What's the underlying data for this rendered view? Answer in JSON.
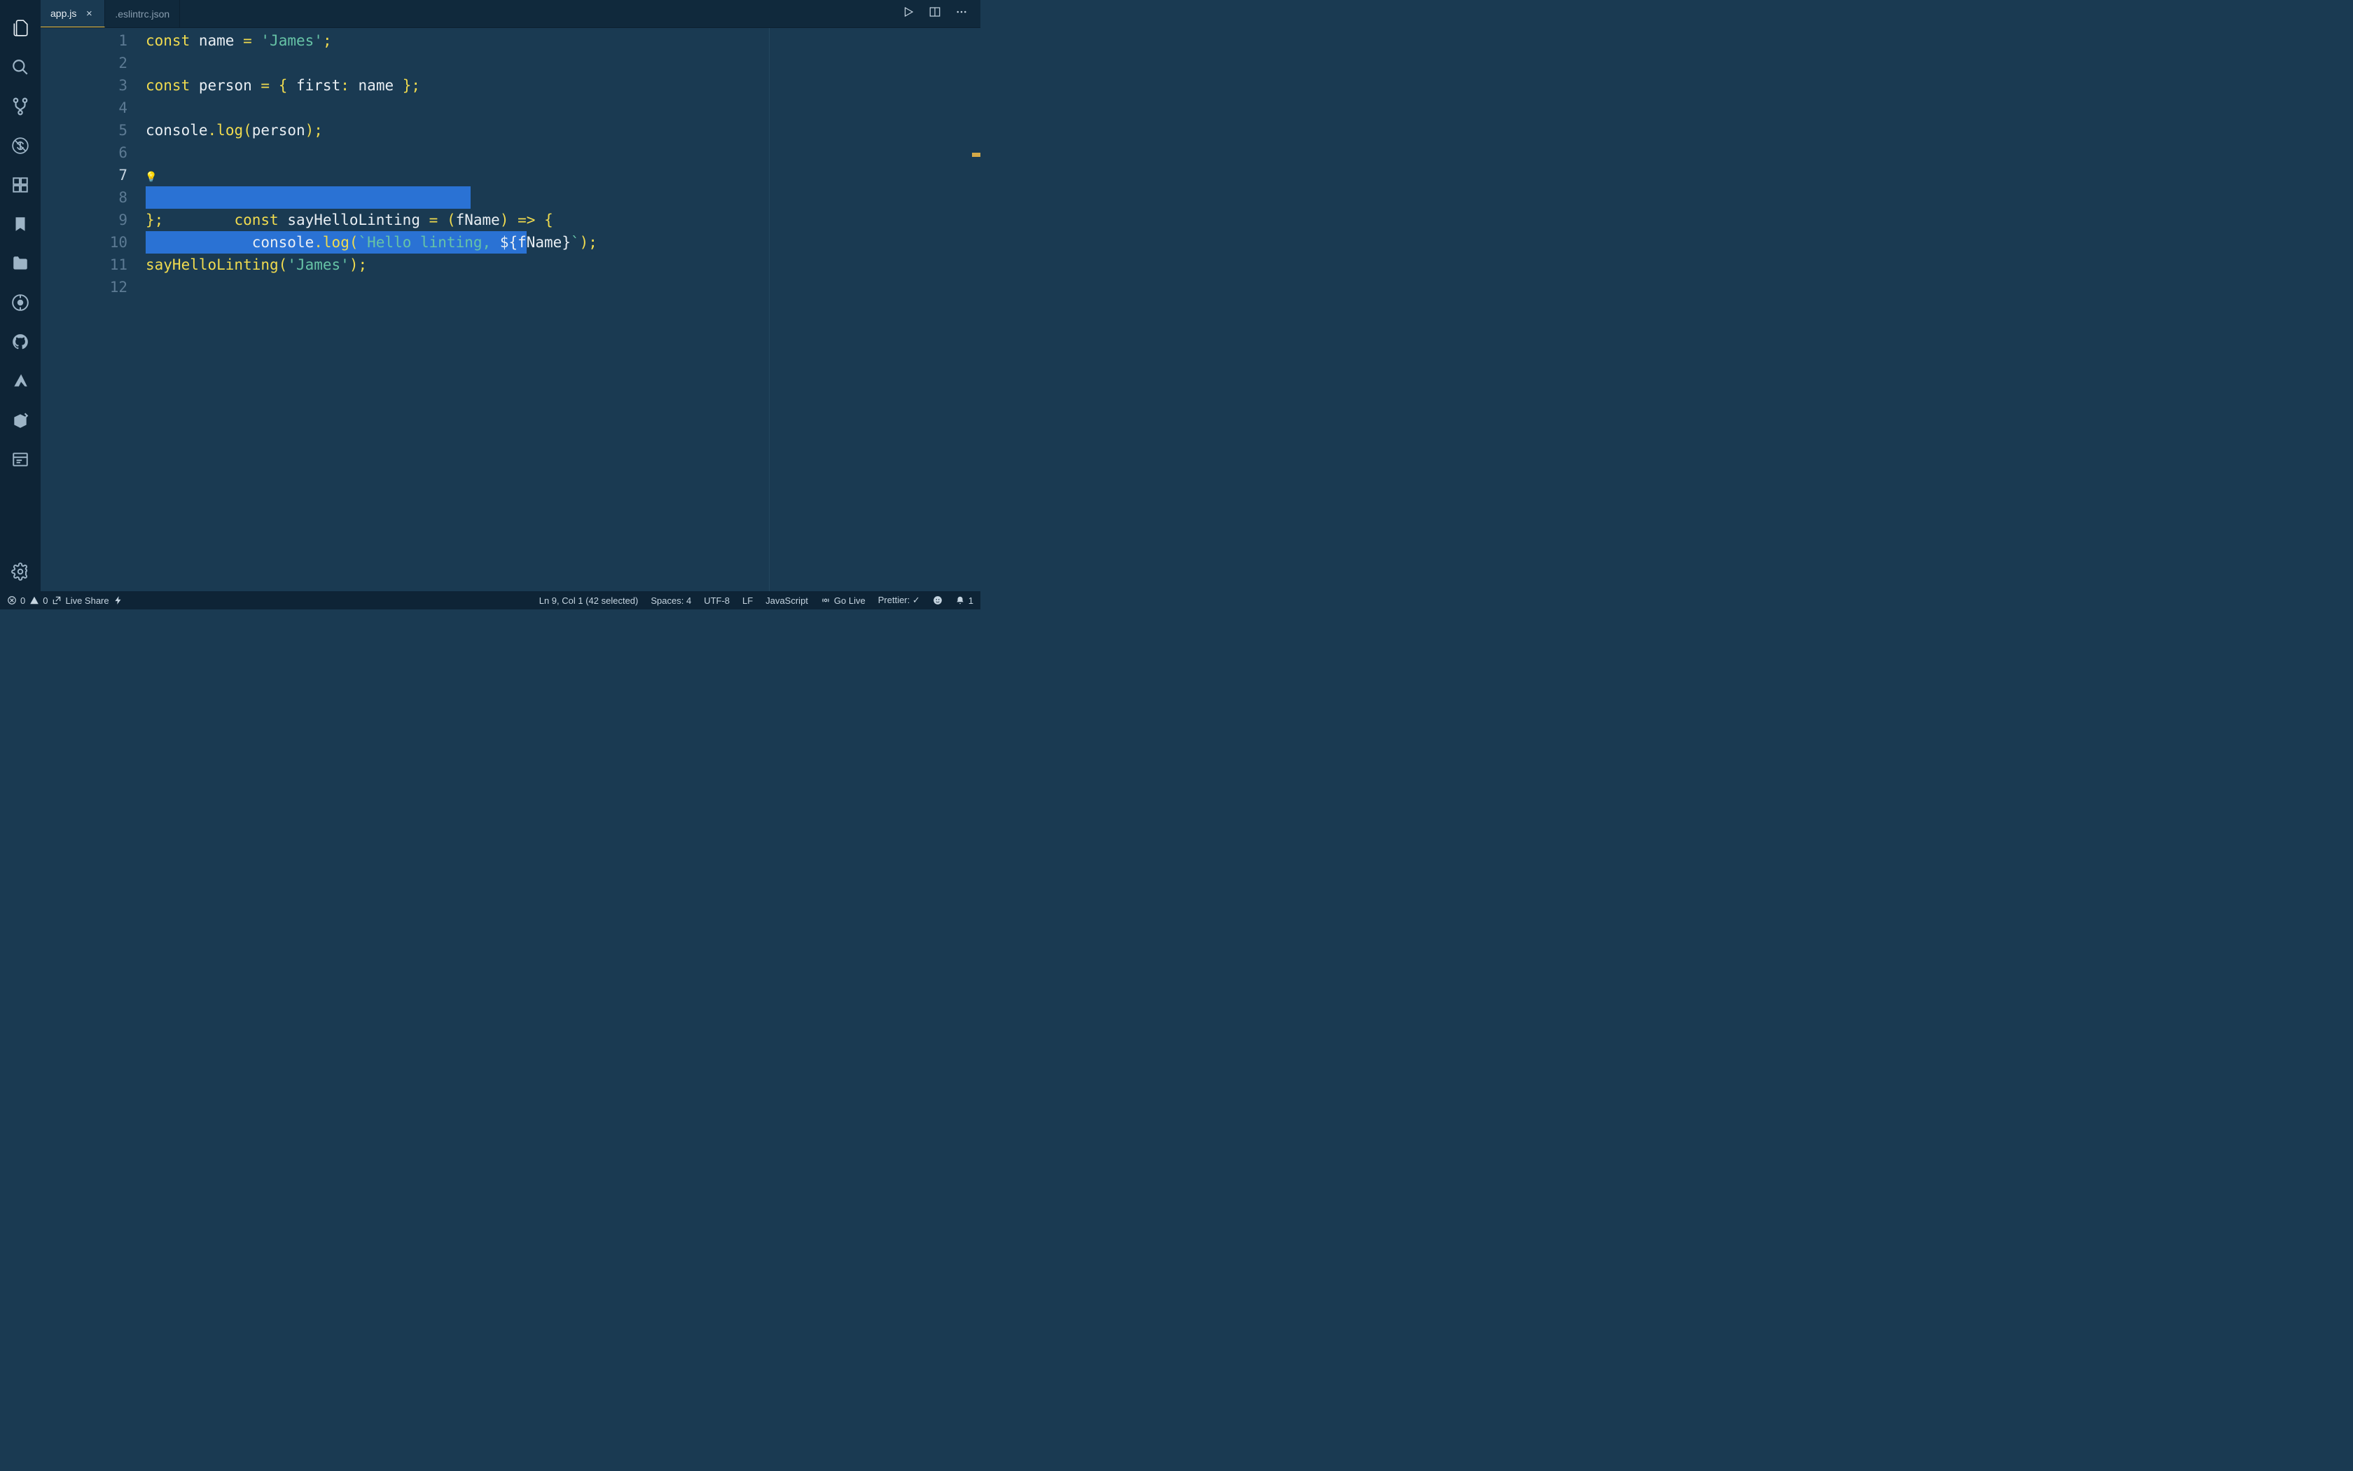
{
  "tabs": [
    {
      "label": "app.js",
      "active": true,
      "dirty": false
    },
    {
      "label": ".eslintrc.json",
      "active": false,
      "dirty": false
    }
  ],
  "activity_bar": {
    "items": [
      {
        "name": "explorer-icon"
      },
      {
        "name": "search-icon"
      },
      {
        "name": "source-control-icon"
      },
      {
        "name": "debug-disabled-icon"
      },
      {
        "name": "extensions-icon"
      },
      {
        "name": "bookmark-icon"
      },
      {
        "name": "files-folder-icon"
      },
      {
        "name": "gitlens-icon"
      },
      {
        "name": "github-icon"
      },
      {
        "name": "azure-icon"
      },
      {
        "name": "live-share-icon"
      },
      {
        "name": "browser-preview-icon"
      }
    ],
    "bottom": [
      {
        "name": "settings-icon"
      }
    ]
  },
  "code": {
    "line_count": 12,
    "current_line": 7,
    "lines": {
      "l1": {
        "kw": "const",
        "sp1": " ",
        "name": "name",
        "sp2": " ",
        "eq": "=",
        "sp3": " ",
        "str": "'James'",
        "semi": ";"
      },
      "l3": {
        "kw": "const",
        "sp1": " ",
        "name": "person",
        "sp2": " ",
        "eq": "=",
        "sp3": " ",
        "lb": "{ ",
        "key": "first",
        "colon": ":",
        "sp4": " ",
        "val": "name",
        "rb": " }",
        "semi": ";"
      },
      "l5": {
        "obj": "console",
        "dot": ".",
        "fn": "log",
        "lp": "(",
        "arg": "person",
        "rp": ")",
        "semi": ";"
      },
      "l7": {
        "kw": "const",
        "sp1": " ",
        "name": "sayHelloLinting",
        "sp2": " ",
        "eq": "=",
        "sp3": " ",
        "lp": "(",
        "param": "fName",
        "rp": ")",
        "sp4": " ",
        "arrow": "=>",
        "sp5": " ",
        "lb": "{"
      },
      "l8": {
        "indent": "  ",
        "obj": "console",
        "dot": ".",
        "fn": "log",
        "lp": "(",
        "bt1": "`",
        "txt": "Hello linting, ",
        "dopen": "${",
        "var": "fName",
        "dclose": "}",
        "bt2": "`",
        "rp": ")",
        "semi": ";"
      },
      "l9": {
        "rb": "}",
        "semi": ";"
      },
      "l11": {
        "fn": "sayHelloLinting",
        "lp": "(",
        "str": "'James'",
        "rp": ")",
        "semi": ";"
      }
    }
  },
  "status": {
    "errors": "0",
    "warnings": "0",
    "live_share": "Live Share",
    "cursor": "Ln 9, Col 1 (42 selected)",
    "spaces": "Spaces: 4",
    "encoding": "UTF-8",
    "eol": "LF",
    "language": "JavaScript",
    "go_live": "Go Live",
    "prettier": "Prettier: ✓",
    "notifications": "1"
  }
}
